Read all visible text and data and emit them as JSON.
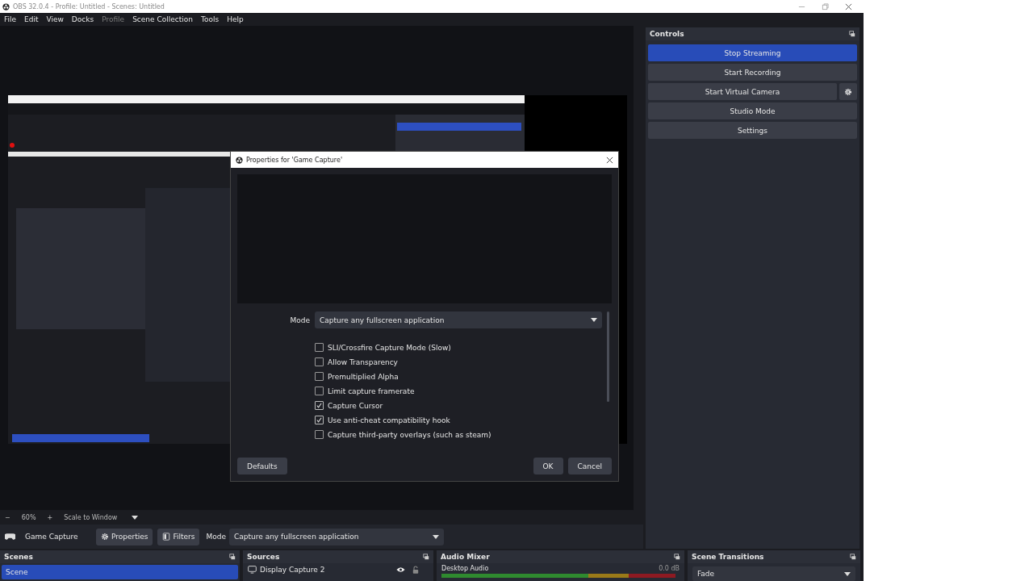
{
  "window": {
    "title": "OBS 32.0.4 - Profile: Untitled - Scenes: Untitled"
  },
  "menu": [
    {
      "label": "File",
      "disabled": false
    },
    {
      "label": "Edit",
      "disabled": false
    },
    {
      "label": "View",
      "disabled": false
    },
    {
      "label": "Docks",
      "disabled": false
    },
    {
      "label": "Profile",
      "disabled": true
    },
    {
      "label": "Scene Collection",
      "disabled": false
    },
    {
      "label": "Tools",
      "disabled": false
    },
    {
      "label": "Help",
      "disabled": false
    }
  ],
  "dialog": {
    "title": "Properties for 'Game Capture'",
    "mode_label": "Mode",
    "mode_value": "Capture any fullscreen application",
    "options": [
      {
        "label": "SLI/Crossfire Capture Mode (Slow)",
        "checked": false
      },
      {
        "label": "Allow Transparency",
        "checked": false
      },
      {
        "label": "Premultiplied Alpha",
        "checked": false
      },
      {
        "label": "Limit capture framerate",
        "checked": false
      },
      {
        "label": "Capture Cursor",
        "checked": true
      },
      {
        "label": "Use anti-cheat compatibility hook",
        "checked": true
      },
      {
        "label": "Capture third-party overlays (such as steam)",
        "checked": false
      }
    ],
    "defaults": "Defaults",
    "ok": "OK",
    "cancel": "Cancel"
  },
  "zoom_bar": {
    "zoom_out": "−",
    "zoom": "60%",
    "zoom_in": "+",
    "scale_mode": "Scale to Window"
  },
  "source_toolbar": {
    "source": "Game Capture",
    "properties": "Properties",
    "filters": "Filters",
    "mode_label": "Mode",
    "mode_value": "Capture any fullscreen application"
  },
  "controls": {
    "title": "Controls",
    "buttons": [
      {
        "label": "Stop Streaming",
        "active": true,
        "kind": "plain"
      },
      {
        "label": "Start Recording",
        "active": false,
        "kind": "plain"
      },
      {
        "label": "Start Virtual Camera",
        "active": false,
        "kind": "with-settings"
      },
      {
        "label": "Studio Mode",
        "active": false,
        "kind": "plain"
      },
      {
        "label": "Settings",
        "active": false,
        "kind": "plain"
      }
    ]
  },
  "scenes": {
    "title": "Scenes",
    "items": [
      {
        "label": "Scene",
        "selected": true
      }
    ]
  },
  "sources": {
    "title": "Sources",
    "items": [
      {
        "label": "Display Capture 2"
      }
    ]
  },
  "audio_mixer": {
    "title": "Audio Mixer",
    "channels": [
      {
        "name": "Desktop Audio",
        "reading": "0.0 dB"
      }
    ]
  },
  "transitions": {
    "title": "Scene Transitions",
    "value": "Fade"
  }
}
